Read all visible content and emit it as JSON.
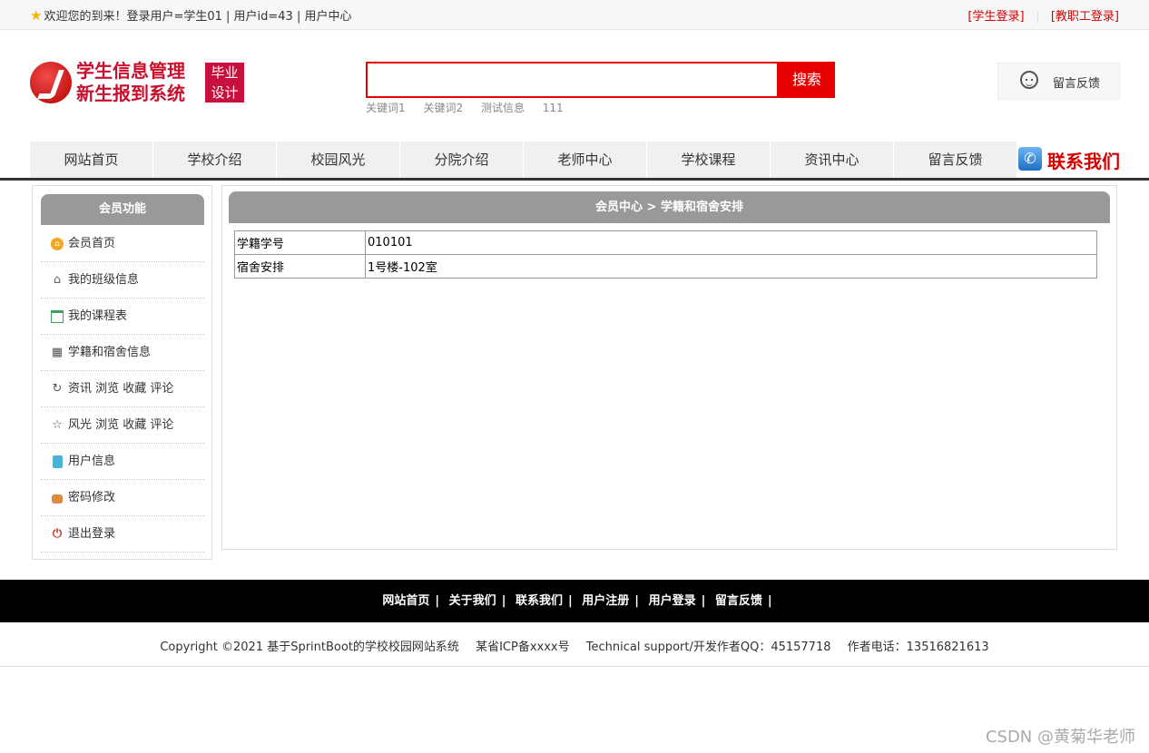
{
  "topbar": {
    "welcome": "欢迎您的到来！登录用户=学生01 | 用户id=43 | 用户中心",
    "student_login": "[学生登录]",
    "staff_login": "[教职工登录]"
  },
  "header": {
    "logo_line1": "学生信息管理",
    "logo_line2": "新生报到系统",
    "logo_tag1": "毕业",
    "logo_tag2": "设计",
    "search_placeholder": "",
    "search_button": "搜索",
    "keywords": [
      "关键词1",
      "关键词2",
      "测试信息",
      "111"
    ],
    "feedback": "留言反馈"
  },
  "nav": {
    "items": [
      "网站首页",
      "学校介绍",
      "校园风光",
      "分院介绍",
      "老师中心",
      "学校课程",
      "资讯中心",
      "留言反馈"
    ],
    "contact": "联系我们"
  },
  "sidebar": {
    "title": "会员功能",
    "items": [
      {
        "label": "会员首页",
        "icon": "home-circle-icon"
      },
      {
        "label": "我的班级信息",
        "icon": "house-icon"
      },
      {
        "label": "我的课程表",
        "icon": "calendar-icon"
      },
      {
        "label": "学籍和宿舍信息",
        "icon": "grid-icon"
      },
      {
        "label": "资讯 浏览 收藏 评论",
        "icon": "history-icon"
      },
      {
        "label": "风光 浏览 收藏 评论",
        "icon": "star-icon"
      },
      {
        "label": "用户信息",
        "icon": "clipboard-icon"
      },
      {
        "label": "密码修改",
        "icon": "lock-icon"
      },
      {
        "label": "退出登录",
        "icon": "power-icon"
      }
    ]
  },
  "main": {
    "title": "会员中心 > 学籍和宿舍安排",
    "rows": [
      {
        "key": "学籍学号",
        "value": "010101"
      },
      {
        "key": "宿舍安排",
        "value": "1号楼-102室"
      }
    ]
  },
  "footer": {
    "links": [
      "网站首页",
      "关于我们",
      "联系我们",
      "用户注册",
      "用户登录",
      "留言反馈"
    ],
    "copyright": "Copyright ©2021 基于SprintBoot的学校校园网站系统",
    "icp": "某省ICP备xxxx号",
    "support": "Technical support/开发作者QQ：45157718",
    "phone": "作者电话：13516821613"
  },
  "watermark": "CSDN @黄菊华老师"
}
